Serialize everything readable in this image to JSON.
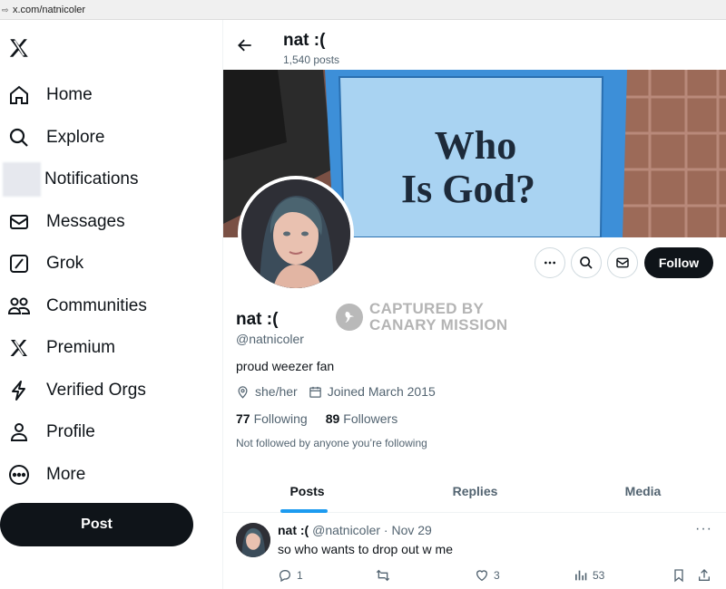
{
  "browser": {
    "url": "x.com/natnicoler"
  },
  "sidebar": {
    "logo": "X",
    "items": [
      {
        "label": "Home",
        "icon": "home-icon"
      },
      {
        "label": "Explore",
        "icon": "search-icon"
      },
      {
        "label": "Notifications",
        "icon": "bell-icon"
      },
      {
        "label": "Messages",
        "icon": "envelope-icon"
      },
      {
        "label": "Grok",
        "icon": "grok-icon"
      },
      {
        "label": "Communities",
        "icon": "people-icon"
      },
      {
        "label": "Premium",
        "icon": "x-logo-icon"
      },
      {
        "label": "Verified Orgs",
        "icon": "lightning-icon"
      },
      {
        "label": "Profile",
        "icon": "person-icon"
      },
      {
        "label": "More",
        "icon": "more-circle-icon"
      }
    ],
    "post_label": "Post"
  },
  "header": {
    "name": "nat :(",
    "post_count": "1,540 posts"
  },
  "banner": {
    "sign_line1": "Who",
    "sign_line2": "Is God?"
  },
  "profile": {
    "display_name": "nat :(",
    "handle": "@natnicoler",
    "bio": "proud weezer fan",
    "pronouns": "she/her",
    "joined": "Joined March 2015",
    "following_count": "77",
    "following_label": "Following",
    "followers_count": "89",
    "followers_label": "Followers",
    "mutuals_note": "Not followed by anyone you’re following",
    "follow_label": "Follow"
  },
  "watermark": {
    "line1": "CAPTURED BY",
    "line2": "CANARY MISSION"
  },
  "tabs": [
    {
      "label": "Posts",
      "active": true
    },
    {
      "label": "Replies",
      "active": false
    },
    {
      "label": "Media",
      "active": false
    }
  ],
  "tweet": {
    "name": "nat :(",
    "handle": "@natnicoler",
    "separator": "·",
    "date": "Nov 29",
    "text": "so who wants to drop out w me",
    "replies": "1",
    "likes": "3",
    "views": "53"
  },
  "colors": {
    "accent": "#1d9bf0",
    "text": "#0f1419",
    "muted": "#536471",
    "button_dark": "#0f1419"
  }
}
